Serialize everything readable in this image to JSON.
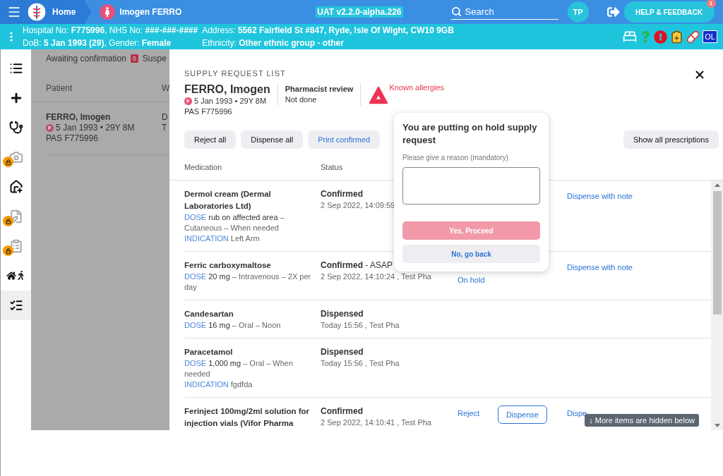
{
  "topbar": {
    "home": "Home",
    "patient": "Imogen FERRO",
    "version": "UAT v2.2.0-alpha.226",
    "search": {
      "placeholder": "Search"
    },
    "user_initials": "TP",
    "help": {
      "label": "HELP & FEEDBACK",
      "badge": "1"
    }
  },
  "banner": {
    "left": [
      "Hospital No: **F775996**, NHS No: **###-###-####**",
      "DoB: **5 Jan 1993 (29)**, Gender: **Female**"
    ],
    "right": [
      "Address: **5562 Fairfield St #847, Ryde, Isle Of Wight, CW10 9GB**",
      "Ethnicity: **Other ethnic group - other**"
    ],
    "icons": [
      {
        "kind": "bed"
      },
      {
        "kind": "question"
      },
      {
        "kind": "alert"
      },
      {
        "kind": "clipboard"
      },
      {
        "kind": "pill"
      },
      {
        "kind": "text",
        "label": "OL"
      }
    ]
  },
  "sidebar": {
    "items": [
      {
        "kind": "list",
        "locked": false,
        "selected": false
      },
      {
        "kind": "plus",
        "locked": false,
        "selected": false
      },
      {
        "kind": "stethoscope",
        "locked": false,
        "selected": false
      },
      {
        "kind": "camera",
        "locked": true,
        "selected": false
      },
      {
        "kind": "house-plus",
        "locked": false,
        "selected": false
      },
      {
        "kind": "file-edit",
        "locked": true,
        "selected": false
      },
      {
        "kind": "clipboard",
        "locked": true,
        "selected": false
      },
      {
        "kind": "house-walk",
        "locked": false,
        "selected": false
      },
      {
        "kind": "checklist",
        "locked": false,
        "selected": true
      }
    ]
  },
  "background": {
    "tabs": [
      {
        "label": "Awaiting confirmation",
        "count": "0"
      },
      {
        "label": "Suspe"
      }
    ],
    "columns": [
      "Patient",
      "W"
    ],
    "row": {
      "name": "FERRO, Imogen",
      "sex": "F",
      "dob": "5 Jan 1993 • 29Y 8M",
      "pas": "PAS F775996",
      "column_2": [
        "D",
        "T"
      ]
    }
  },
  "drawer": {
    "title": "SUPPLY REQUEST LIST",
    "patient": {
      "name": "FERRO, Imogen",
      "sex": "F",
      "dob": "5 Jan 1993 • 29Y 8M",
      "pas": "PAS F775996"
    },
    "review": {
      "label": "Pharmacist review",
      "value": "Not done"
    },
    "allergies": "Known allergies",
    "buttons": [
      {
        "label": "Reject all",
        "kind": "plain"
      },
      {
        "label": "Dispense all",
        "kind": "plain"
      },
      {
        "label": "Print confirmed",
        "kind": "link"
      }
    ],
    "show_all": "Show all prescriptions",
    "columns": [
      "Medication",
      "Status"
    ],
    "rows": [
      {
        "name": "Dermol cream (Dermal Laboratories Ltd)",
        "dose": {
          "label": "DOSE",
          "amount": "rub on affected area",
          "rest": " – Cutaneous – When needed"
        },
        "indication": {
          "label": "INDICATION",
          "value": "Left Arm"
        },
        "status": "Confirmed",
        "when": "2 Sep 2022, 14:09:59",
        "actions": [
          {
            "kind": "note",
            "label": "Dispense with note"
          }
        ]
      },
      {
        "name": "Ferric carboxymaltose",
        "dose": {
          "label": "DOSE",
          "amount": "20 mg",
          "rest": " – Intravenous – 2X per day"
        },
        "status": "Confirmed",
        "status_note": " - ASAP",
        "when": "2 Sep 2022, 14:10:24 , Test Pha",
        "actions": [
          {
            "kind": "hold",
            "label": "On hold"
          },
          {
            "kind": "note",
            "label": "Dispense with note"
          }
        ]
      },
      {
        "name": "Candesartan",
        "dose": {
          "label": "DOSE",
          "amount": "16 mg",
          "rest": " – Oral – Noon"
        },
        "status": "Dispensed",
        "when": "Today 15:56 , Test Pha",
        "actions": []
      },
      {
        "name": "Paracetamol",
        "dose": {
          "label": "DOSE",
          "amount": "1,000 mg",
          "rest": " – Oral – When needed"
        },
        "indication": {
          "label": "INDICATION",
          "value": "fgdfda"
        },
        "status": "Dispensed",
        "when": "Today 15:56 , Test Pha",
        "actions": []
      },
      {
        "name": "Ferinject 100mg/2ml solution for injection vials (Vifor Pharma",
        "status": "Confirmed",
        "when": "2 Sep 2022, 14:10:41 , Test Pha",
        "actions": [
          {
            "kind": "reject",
            "label": "Reject"
          },
          {
            "kind": "dispense",
            "label": "Dispense"
          },
          {
            "kind": "note",
            "label": "Dispe"
          }
        ]
      }
    ],
    "more_hint": "↓ More items are hidden below"
  },
  "popover": {
    "title": "You are putting on hold supply request",
    "label": "Please give a reason (mandatory)",
    "buttons": [
      {
        "label": "Yes, Proceed",
        "disabled": true
      },
      {
        "label": "No, go back",
        "disabled": false
      }
    ]
  }
}
